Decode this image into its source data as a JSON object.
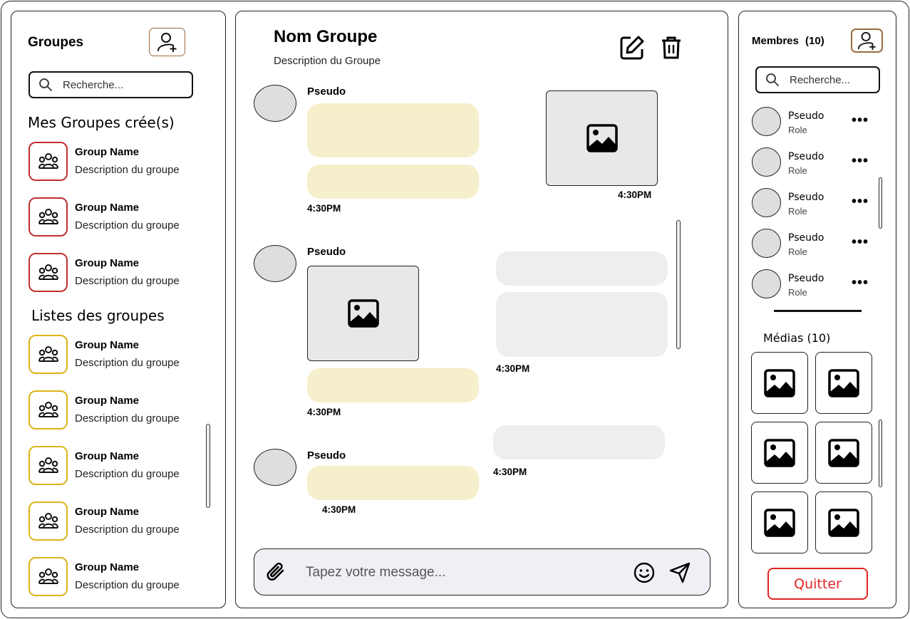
{
  "groups_panel": {
    "title": "Groupes",
    "search_placeholder": "Recherche...",
    "my_groups_title": "Mes Groupes crée(s)",
    "my_groups": [
      {
        "name": "Group Name",
        "description": "Description du groupe"
      },
      {
        "name": "Group Name",
        "description": "Description du groupe"
      },
      {
        "name": "Group Name",
        "description": "Description du groupe"
      }
    ],
    "all_groups_title": "Listes des groupes",
    "all_groups": [
      {
        "name": "Group Name",
        "description": "Description du groupe"
      },
      {
        "name": "Group Name",
        "description": "Description du groupe"
      },
      {
        "name": "Group Name",
        "description": "Description du groupe"
      },
      {
        "name": "Group Name",
        "description": "Description du groupe"
      },
      {
        "name": "Group Name",
        "description": "Description du groupe"
      }
    ]
  },
  "chat": {
    "group_name": "Nom Groupe",
    "group_description": "Description du Groupe",
    "messages": [
      {
        "sender": "Pseudo",
        "time": "4:30PM"
      },
      {
        "sender": "Pseudo",
        "time": "4:30PM"
      },
      {
        "sender": "Pseudo",
        "time": "4:30PM"
      }
    ],
    "own_times": [
      "4:30PM",
      "4:30PM",
      "4:30PM"
    ],
    "composer_placeholder": "Tapez votre message..."
  },
  "members_panel": {
    "title": "Membres",
    "count": "(10)",
    "search_placeholder": "Recherche...",
    "members": [
      {
        "name": "Pseudo",
        "role": "Role"
      },
      {
        "name": "Pseudo",
        "role": "Role"
      },
      {
        "name": "Pseudo",
        "role": "Role"
      },
      {
        "name": "Pseudo",
        "role": "Role"
      },
      {
        "name": "Pseudo",
        "role": "Role"
      }
    ],
    "more_label": "•••",
    "media_title": "Médias (10)",
    "media_count_tiles": 6,
    "quit_label": "Quitter"
  },
  "colors": {
    "my_group_border": "#c22f2f",
    "group_border": "#dcb417",
    "received_bubble": "#f6efcb",
    "sent_bubble": "#eeeeee",
    "quit": "#e02424",
    "composer_bg": "#eff0f6"
  },
  "icons": {
    "add_group": "user-plus-icon",
    "search": "search-icon",
    "group": "users-icon",
    "edit": "edit-icon",
    "delete": "trash-icon",
    "image": "image-icon",
    "attach": "paperclip-icon",
    "emoji": "emoji-icon",
    "send": "send-icon",
    "add_member": "user-plus-icon"
  }
}
